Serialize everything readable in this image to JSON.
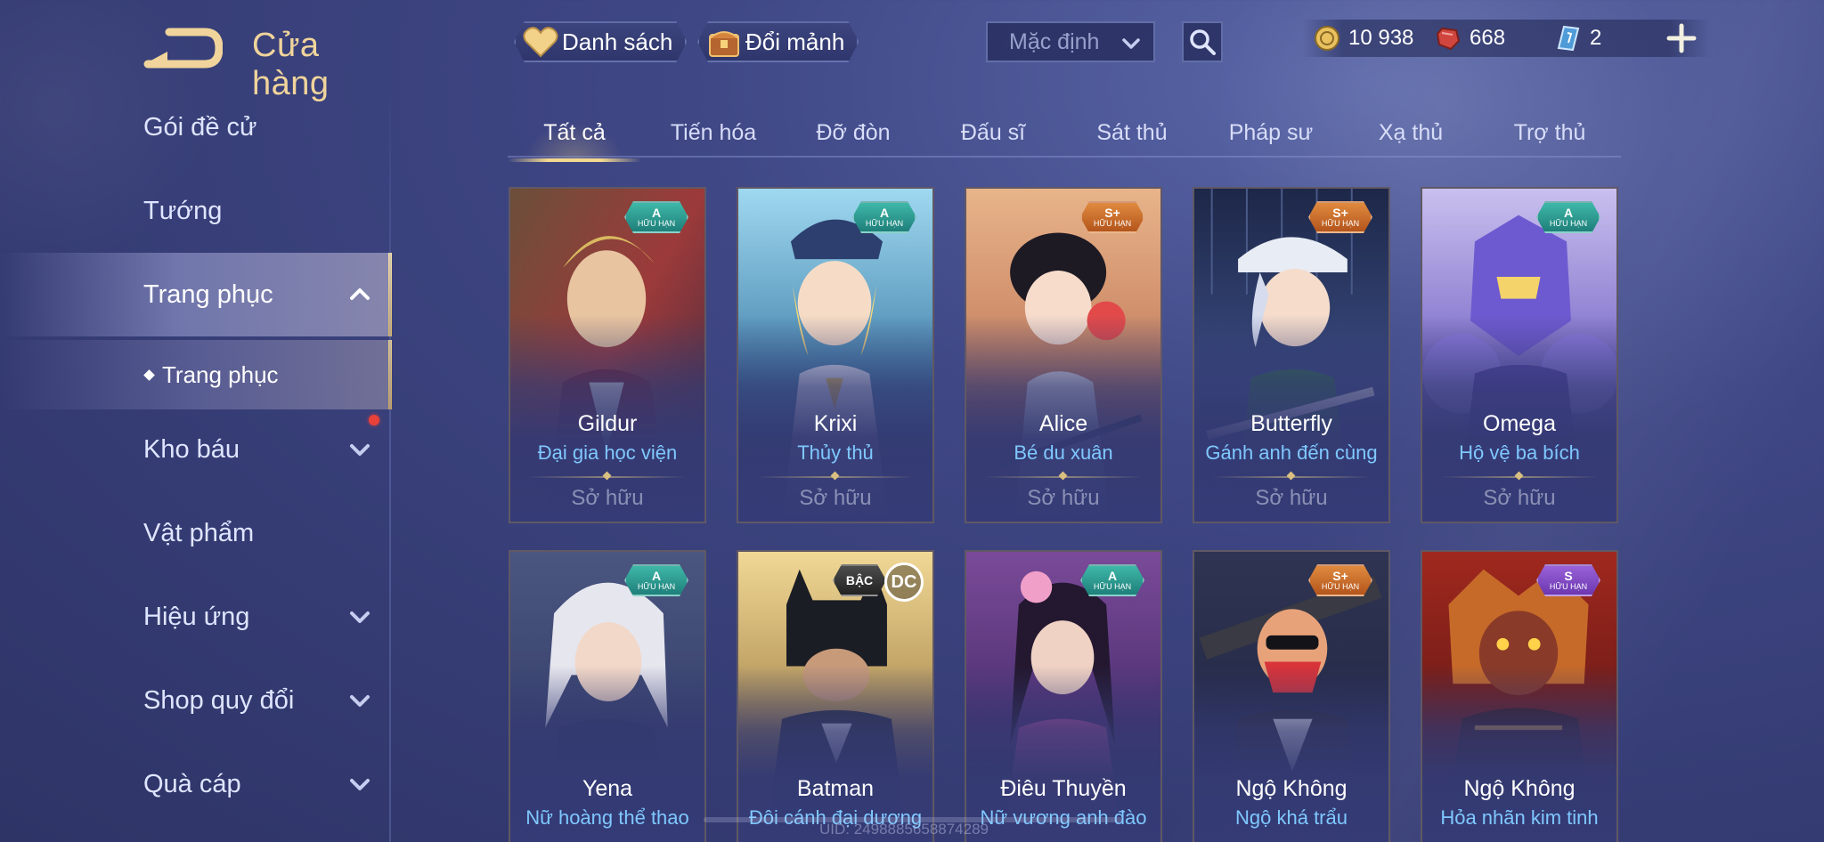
{
  "header": {
    "title": "Cửa hàng",
    "wishlist_label": "Danh sách",
    "exchange_label": "Đổi mảnh",
    "sort_value": "Mặc định"
  },
  "currencies": {
    "gold": "10 938",
    "vouchers": "668",
    "tickets": "2"
  },
  "sidebar": {
    "items": [
      {
        "label": "Gói đề cử"
      },
      {
        "label": "Tướng"
      },
      {
        "label": "Trang phục"
      },
      {
        "label": "Kho báu"
      },
      {
        "label": "Vật phẩm"
      },
      {
        "label": "Hiệu ứng"
      },
      {
        "label": "Shop quy đổi"
      },
      {
        "label": "Quà cáp"
      }
    ],
    "submenu_label": "Trang phục"
  },
  "tabs": [
    {
      "label": "Tất cả"
    },
    {
      "label": "Tiến hóa"
    },
    {
      "label": "Đỡ đòn"
    },
    {
      "label": "Đấu sĩ"
    },
    {
      "label": "Sát thủ"
    },
    {
      "label": "Pháp sư"
    },
    {
      "label": "Xạ thủ"
    },
    {
      "label": "Trợ thủ"
    }
  ],
  "cards": [
    {
      "hero": "Gildur",
      "skin": "Đại gia học viện",
      "status": "Sở hữu",
      "tier": "A",
      "tag": "HỮU HẠN"
    },
    {
      "hero": "Krixi",
      "skin": "Thủy thủ",
      "status": "Sở hữu",
      "tier": "A",
      "tag": "HỮU HẠN"
    },
    {
      "hero": "Alice",
      "skin": "Bé du xuân",
      "status": "Sở hữu",
      "tier": "S+",
      "tag": "HỮU HẠN"
    },
    {
      "hero": "Butterfly",
      "skin": "Gánh anh đến cùng",
      "status": "Sở hữu",
      "tier": "S+",
      "tag": "HỮU HẠN"
    },
    {
      "hero": "Omega",
      "skin": "Hộ vệ ba bích",
      "status": "Sở hữu",
      "tier": "A",
      "tag": "HỮU HẠN"
    },
    {
      "hero": "Yena",
      "skin": "Nữ hoàng thể thao",
      "tier": "A",
      "tag": "HỮU HẠN"
    },
    {
      "hero": "Batman",
      "skin": "Đôi cánh đại dương",
      "tier": "BẬC",
      "tag": "DC"
    },
    {
      "hero": "Điêu Thuyền",
      "skin": "Nữ vương anh đào",
      "tier": "A",
      "tag": "HỮU HẠN"
    },
    {
      "hero": "Ngộ Không",
      "skin": "Ngộ khá trẩu",
      "tier": "S+",
      "tag": "HỮU HẠN"
    },
    {
      "hero": "Ngộ Không",
      "skin": "Hỏa nhãn kim tinh",
      "tier": "S",
      "tag": "HỮU HẠN"
    }
  ],
  "footer": {
    "uid": "UID: 2498885658874289"
  },
  "colors": {
    "accent_gold": "#f0d49b",
    "skin_name": "#7fc8ff",
    "tier_a": "#3fb8a8",
    "tier_s_plus": "#e08a3f",
    "tier_s": "#9a62d8"
  }
}
